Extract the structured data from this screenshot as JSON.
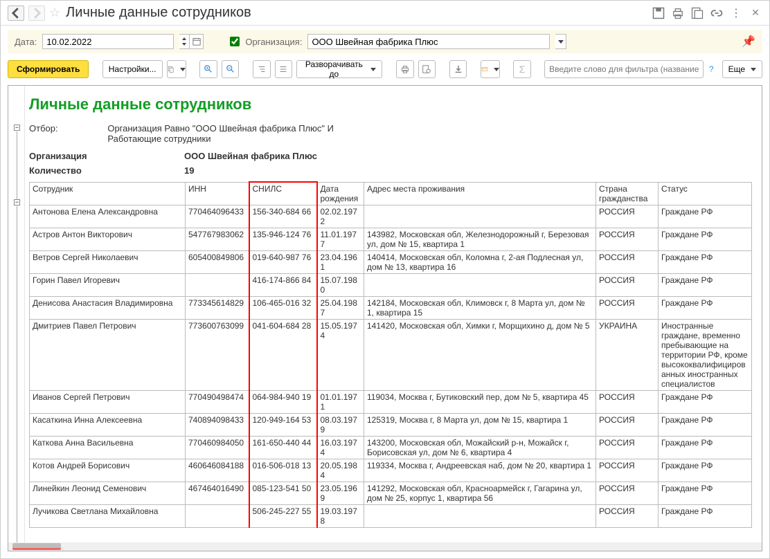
{
  "title": "Личные данные сотрудников",
  "filter": {
    "date_label": "Дата:",
    "date_value": "10.02.2022",
    "org_label": "Организация:",
    "org_value": "ООО Швейная фабрика Плюс"
  },
  "toolbar": {
    "generate": "Сформировать",
    "settings": "Настройки...",
    "expand": "Разворачивать до",
    "filter_placeholder": "Введите слово для фильтра (название тов...",
    "more": "Еще"
  },
  "report": {
    "heading": "Личные данные сотрудников",
    "filter_label": "Отбор:",
    "filter_text": "Организация Равно \"ООО Швейная фабрика Плюс\" И\nРаботающие сотрудники",
    "org_label": "Организация",
    "org_value": "ООО Швейная фабрика Плюс",
    "count_label": "Количество",
    "count_value": "19",
    "columns": {
      "employee": "Сотрудник",
      "inn": "ИНН",
      "snils": "СНИЛС",
      "bdate": "Дата рождения",
      "address": "Адрес места проживания",
      "country": "Страна гражданства",
      "status": "Статус"
    },
    "rows": [
      {
        "employee": "Антонова Елена Александровна",
        "inn": "770464096433",
        "snils": "156-340-684 66",
        "bdate": "02.02.1972",
        "address": "",
        "country": "РОССИЯ",
        "status": "Граждане РФ"
      },
      {
        "employee": "Астров Антон Викторович",
        "inn": "547767983062",
        "snils": "135-946-124 76",
        "bdate": "11.01.1977",
        "address": "143982, Московская обл, Железнодорожный г, Березовая ул, дом № 15, квартира 1",
        "country": "РОССИЯ",
        "status": "Граждане РФ"
      },
      {
        "employee": "Ветров Сергей Николаевич",
        "inn": "605400849806",
        "snils": "019-640-987 76",
        "bdate": "23.04.1961",
        "address": "140414, Московская обл, Коломна г, 2-ая Подлесная ул, дом № 13, квартира 16",
        "country": "РОССИЯ",
        "status": "Граждане РФ"
      },
      {
        "employee": "Горин Павел Игоревич",
        "inn": "",
        "snils": "416-174-866 84",
        "bdate": "15.07.1980",
        "address": "",
        "country": "РОССИЯ",
        "status": "Граждане РФ"
      },
      {
        "employee": "Денисова Анастасия Владимировна",
        "inn": "773345614829",
        "snils": "106-465-016 32",
        "bdate": "25.04.1987",
        "address": "142184, Московская обл, Климовск г, 8 Марта ул, дом № 1, квартира 15",
        "country": "РОССИЯ",
        "status": "Граждане РФ"
      },
      {
        "employee": "Дмитриев Павел Петрович",
        "inn": "773600763099",
        "snils": "041-604-684 28",
        "bdate": "15.05.1974",
        "address": "141420, Московская обл, Химки г, Морщихино д, дом № 5",
        "country": "УКРАИНА",
        "status": "Иностранные граждане, временно пребывающие на территории РФ, кроме высококвалифицированных иностранных специалистов"
      },
      {
        "employee": "Иванов Сергей Петрович",
        "inn": "770490498474",
        "snils": "064-984-940 19",
        "bdate": "01.01.1971",
        "address": "119034, Москва г, Бутиковский пер, дом № 5, квартира 45",
        "country": "РОССИЯ",
        "status": "Граждане РФ"
      },
      {
        "employee": "Касаткина Инна Алексеевна",
        "inn": "740894098433",
        "snils": "120-949-164 53",
        "bdate": "08.03.1979",
        "address": "125319, Москва г, 8 Марта ул, дом № 15, квартира 1",
        "country": "РОССИЯ",
        "status": "Граждане РФ"
      },
      {
        "employee": "Каткова Анна Васильевна",
        "inn": "770460984050",
        "snils": "161-650-440 44",
        "bdate": "16.03.1974",
        "address": "143200, Московская обл, Можайский р-н, Можайск г, Борисовская ул, дом № 6, квартира 4",
        "country": "РОССИЯ",
        "status": "Граждане РФ"
      },
      {
        "employee": "Котов Андрей Борисович",
        "inn": "460646084188",
        "snils": "016-506-018 13",
        "bdate": "20.05.1984",
        "address": "119334, Москва г, Андреевская наб, дом № 20, квартира 1",
        "country": "РОССИЯ",
        "status": "Граждане РФ"
      },
      {
        "employee": "Линейкин Леонид Семенович",
        "inn": "467464016490",
        "snils": "085-123-541 50",
        "bdate": "23.05.1969",
        "address": "141292, Московская обл, Красноармейск г, Гагарина ул, дом № 25, корпус 1, квартира 56",
        "country": "РОССИЯ",
        "status": "Граждане РФ"
      },
      {
        "employee": "Лучикова Светлана Михайловна",
        "inn": "",
        "snils": "506-245-227 55",
        "bdate": "19.03.1978",
        "address": "",
        "country": "РОССИЯ",
        "status": "Граждане РФ"
      }
    ]
  }
}
